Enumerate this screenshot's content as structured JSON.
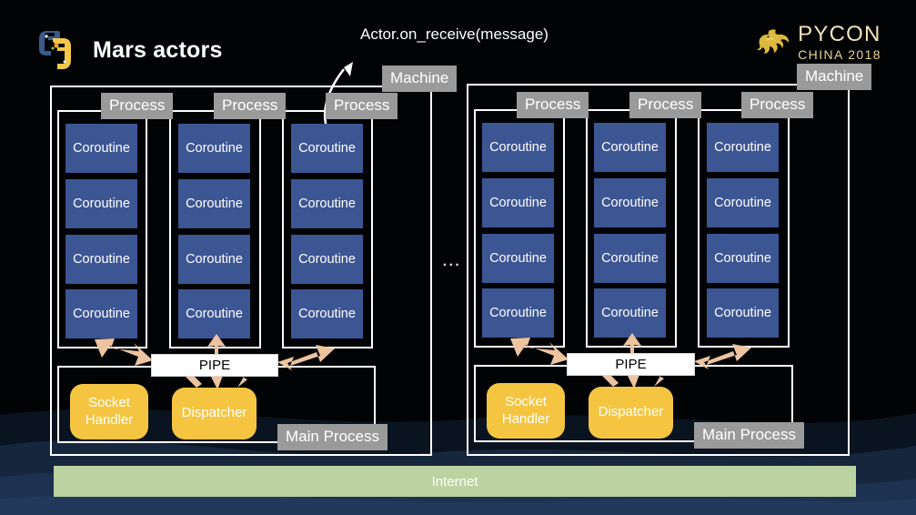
{
  "slide": {
    "title": "Mars actors",
    "background_color": "#010305",
    "callout": "Actor.on_receive(message)",
    "ellipsis": "...",
    "internet_label": "Internet",
    "internet_color": "#bcd3a1"
  },
  "brand": {
    "logo_icon": "python-logo-icon",
    "pycon_top": "PYCON",
    "pycon_bottom": "CHINA 2018",
    "pycon_dragon_icon": "dragon-icon",
    "pycon_color": "#f2e5bb"
  },
  "labels": {
    "machine": "Machine",
    "process": "Process",
    "coroutine": "Coroutine",
    "pipe": "PIPE",
    "main_process": "Main Process",
    "socket_handler_line1": "Socket",
    "socket_handler_line2": "Handler",
    "dispatcher": "Dispatcher"
  },
  "colors": {
    "tag_gray": "#9a9a9a",
    "coroutine_blue": "#3c5593",
    "actor_yellow": "#f5c542",
    "arrow_peach": "#edc3a0",
    "frame_white": "#ffffff"
  },
  "machines": [
    {
      "name": "Machine",
      "processes": [
        {
          "name": "Process",
          "coroutines": [
            "Coroutine",
            "Coroutine",
            "Coroutine",
            "Coroutine"
          ]
        },
        {
          "name": "Process",
          "coroutines": [
            "Coroutine",
            "Coroutine",
            "Coroutine",
            "Coroutine"
          ]
        },
        {
          "name": "Process",
          "coroutines": [
            "Coroutine",
            "Coroutine",
            "Coroutine",
            "Coroutine"
          ]
        }
      ],
      "main_process": {
        "name": "Main Process",
        "actors": [
          "Socket Handler",
          "Dispatcher"
        ],
        "pipe": "PIPE"
      }
    },
    {
      "name": "Machine",
      "processes": [
        {
          "name": "Process",
          "coroutines": [
            "Coroutine",
            "Coroutine",
            "Coroutine",
            "Coroutine"
          ]
        },
        {
          "name": "Process",
          "coroutines": [
            "Coroutine",
            "Coroutine",
            "Coroutine",
            "Coroutine"
          ]
        },
        {
          "name": "Process",
          "coroutines": [
            "Coroutine",
            "Coroutine",
            "Coroutine",
            "Coroutine"
          ]
        }
      ],
      "main_process": {
        "name": "Main Process",
        "actors": [
          "Socket Handler",
          "Dispatcher"
        ],
        "pipe": "PIPE"
      }
    }
  ]
}
